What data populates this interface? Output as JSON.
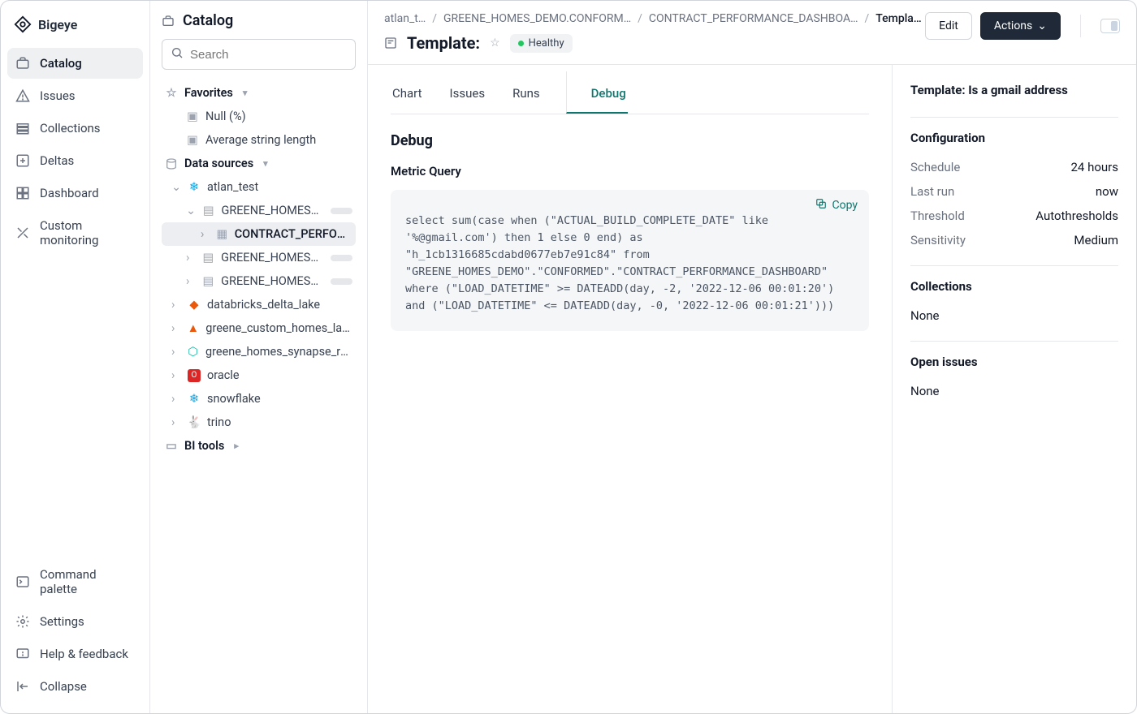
{
  "brand": {
    "name": "Bigeye"
  },
  "nav": {
    "items": [
      {
        "label": "Catalog",
        "active": true
      },
      {
        "label": "Issues",
        "active": false
      },
      {
        "label": "Collections",
        "active": false
      },
      {
        "label": "Deltas",
        "active": false
      },
      {
        "label": "Dashboard",
        "active": false
      },
      {
        "label": "Custom monitoring",
        "active": false
      }
    ],
    "bottom": [
      {
        "label": "Command palette"
      },
      {
        "label": "Settings"
      },
      {
        "label": "Help & feedback"
      },
      {
        "label": "Collapse"
      }
    ]
  },
  "catalog": {
    "title": "Catalog",
    "search_placeholder": "Search",
    "sections": {
      "favorites_label": "Favorites",
      "favorites": [
        {
          "label": "Null (%)"
        },
        {
          "label": "Average string length"
        }
      ],
      "data_sources_label": "Data sources",
      "bi_tools_label": "BI tools"
    },
    "tree": {
      "atlan_test": "atlan_test",
      "greene_a": "GREENE_HOMES_…",
      "contract_perf": "CONTRACT_PERFORM…",
      "greene_b": "GREENE_HOMES_…",
      "greene_c": "GREENE_HOMES_…",
      "databricks": "databricks_delta_lake",
      "greene_custom": "greene_custom_homes_lake…",
      "greene_synapse": "greene_homes_synapse_repl…",
      "oracle": "oracle",
      "snowflake": "snowflake",
      "trino": "trino"
    }
  },
  "breadcrumbs": [
    "atlan_t…",
    "GREENE_HOMES_DEMO.CONFORM…",
    "CONTRACT_PERFORMANCE_DASHBOA…",
    "Templa…"
  ],
  "header": {
    "title_prefix": "Template:",
    "health_label": "Healthy",
    "edit_label": "Edit",
    "actions_label": "Actions"
  },
  "tabs": [
    {
      "label": "Chart",
      "active": false
    },
    {
      "label": "Issues",
      "active": false
    },
    {
      "label": "Runs",
      "active": false
    },
    {
      "label": "Debug",
      "active": true
    }
  ],
  "debug": {
    "heading": "Debug",
    "subheading": "Metric Query",
    "copy_label": "Copy",
    "query": "select sum(case when (\"ACTUAL_BUILD_COMPLETE_DATE\" like '%@gmail.com') then 1 else 0 end) as \"h_1cb1316685cdabd0677eb7e91c84\" from \"GREENE_HOMES_DEMO\".\"CONFORMED\".\"CONTRACT_PERFORMANCE_DASHBOARD\" where (\"LOAD_DATETIME\" >= DATEADD(day, -2, '2022-12-06 00:01:20') and (\"LOAD_DATETIME\" <= DATEADD(day, -0, '2022-12-06 00:01:21')))"
  },
  "details": {
    "title": "Template: Is a gmail address",
    "config_heading": "Configuration",
    "rows": [
      {
        "label": "Schedule",
        "value": "24 hours"
      },
      {
        "label": "Last run",
        "value": "now"
      },
      {
        "label": "Threshold",
        "value": "Autothresholds"
      },
      {
        "label": "Sensitivity",
        "value": "Medium"
      }
    ],
    "collections_heading": "Collections",
    "collections_value": "None",
    "open_issues_heading": "Open issues",
    "open_issues_value": "None"
  }
}
